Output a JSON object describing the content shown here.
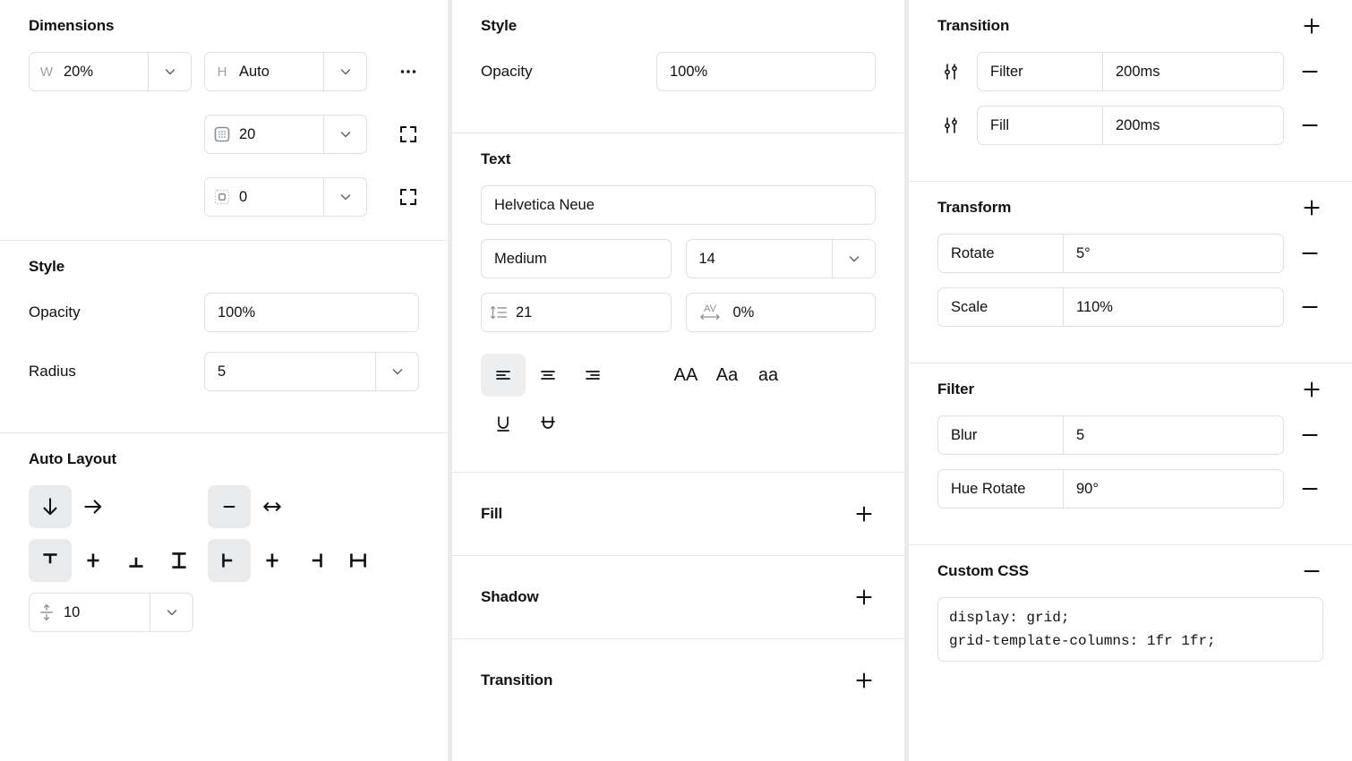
{
  "left": {
    "dimensions": {
      "title": "Dimensions",
      "width": {
        "prefix": "W",
        "value": "20%"
      },
      "height": {
        "prefix": "H",
        "value": "Auto"
      },
      "padding": {
        "icon": "padding-icon",
        "value": "20"
      },
      "margin": {
        "icon": "margin-icon",
        "value": "0"
      },
      "more_icon": "ellipsis-icon",
      "expand_padding_icon": "expand-icon",
      "expand_margin_icon": "expand-icon"
    },
    "style": {
      "title": "Style",
      "opacity_label": "Opacity",
      "opacity_value": "100%",
      "radius_label": "Radius",
      "radius_value": "5"
    },
    "auto_layout": {
      "title": "Auto Layout",
      "direction": [
        {
          "name": "direction-vertical",
          "icon": "arrow-down-icon",
          "active": true
        },
        {
          "name": "direction-horizontal",
          "icon": "arrow-right-icon",
          "active": false
        }
      ],
      "wrap": [
        {
          "name": "wrap-none",
          "icon": "minus-icon",
          "active": true
        },
        {
          "name": "wrap-enabled",
          "icon": "arrows-horizontal-icon",
          "active": false
        }
      ],
      "align_vertical": [
        {
          "name": "align-top",
          "icon": "align-top-icon",
          "active": true
        },
        {
          "name": "align-middle",
          "icon": "align-middle-icon",
          "active": false
        },
        {
          "name": "align-bottom",
          "icon": "align-bottom-icon",
          "active": false
        },
        {
          "name": "align-stretch-vertical",
          "icon": "align-stretch-vertical-icon",
          "active": false
        }
      ],
      "align_horizontal": [
        {
          "name": "align-left",
          "icon": "align-left-icon",
          "active": true
        },
        {
          "name": "align-center",
          "icon": "align-center-icon",
          "active": false
        },
        {
          "name": "align-right",
          "icon": "align-right-icon",
          "active": false
        },
        {
          "name": "align-stretch-horizontal",
          "icon": "align-stretch-horizontal-icon",
          "active": false
        }
      ],
      "gap": {
        "icon": "gap-vertical-icon",
        "value": "10"
      }
    }
  },
  "middle": {
    "style": {
      "title": "Style",
      "opacity_label": "Opacity",
      "opacity_value": "100%"
    },
    "text": {
      "title": "Text",
      "font_family": "Helvetica Neue",
      "font_weight": "Medium",
      "font_size": "14",
      "line_height": {
        "icon": "line-height-icon",
        "value": "21"
      },
      "letter_spacing": {
        "icon": "letter-spacing-icon",
        "value": "0%"
      },
      "align_buttons": [
        {
          "name": "text-align-left",
          "icon": "text-align-left-icon",
          "active": true
        },
        {
          "name": "text-align-center",
          "icon": "text-align-center-icon",
          "active": false
        },
        {
          "name": "text-align-right",
          "icon": "text-align-right-icon",
          "active": false
        }
      ],
      "case_buttons": [
        {
          "name": "text-case-uppercase",
          "label": "AA",
          "active": false
        },
        {
          "name": "text-case-titlecase",
          "label": "Aa",
          "active": false
        },
        {
          "name": "text-case-lowercase",
          "label": "aa",
          "active": false
        }
      ],
      "decoration_buttons": [
        {
          "name": "text-underline",
          "icon": "underline-icon",
          "active": false
        },
        {
          "name": "text-strikethrough",
          "icon": "strikethrough-icon",
          "active": false
        }
      ]
    },
    "collapsed_sections": [
      {
        "title": "Fill",
        "action_icon": "plus-icon"
      },
      {
        "title": "Shadow",
        "action_icon": "plus-icon"
      },
      {
        "title": "Transition",
        "action_icon": "plus-icon"
      }
    ]
  },
  "right": {
    "transition": {
      "title": "Transition",
      "action_icon": "plus-icon",
      "rows": [
        {
          "icon": "sliders-icon",
          "property": "Filter",
          "duration": "200ms",
          "remove_icon": "minus-icon"
        },
        {
          "icon": "sliders-icon",
          "property": "Fill",
          "duration": "200ms",
          "remove_icon": "minus-icon"
        }
      ]
    },
    "transform": {
      "title": "Transform",
      "action_icon": "plus-icon",
      "rows": [
        {
          "property": "Rotate",
          "value": "5°",
          "remove_icon": "minus-icon"
        },
        {
          "property": "Scale",
          "value": "110%",
          "remove_icon": "minus-icon"
        }
      ]
    },
    "filter": {
      "title": "Filter",
      "action_icon": "plus-icon",
      "rows": [
        {
          "property": "Blur",
          "value": "5",
          "remove_icon": "minus-icon"
        },
        {
          "property": "Hue Rotate",
          "value": "90°",
          "remove_icon": "minus-icon"
        }
      ]
    },
    "custom_css": {
      "title": "Custom CSS",
      "action_icon": "minus-icon",
      "code": "display: grid;\ngrid-template-columns: 1fr 1fr;"
    }
  },
  "colors": {
    "background": "#ffffff",
    "panel_gap": "#e9eaec",
    "border": "#dcdfe3",
    "divider": "#e6e8ea",
    "text": "#101113",
    "muted": "#9aa0a8",
    "active_bg": "#e9eaec"
  }
}
